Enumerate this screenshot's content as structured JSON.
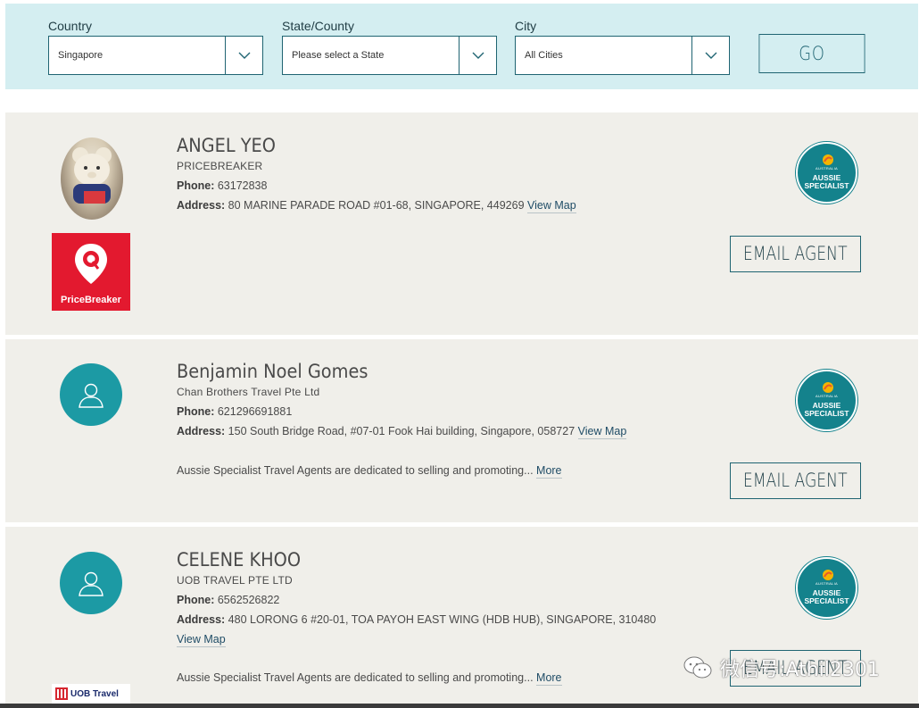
{
  "filters": {
    "country": {
      "label": "Country",
      "value": "Singapore"
    },
    "state": {
      "label": "State/County",
      "value": "Please select a State"
    },
    "city": {
      "label": "City",
      "value": "All Cities"
    },
    "go_label": "GO"
  },
  "agents": [
    {
      "name": "ANGEL YEO",
      "company": "PRICEBREAKER",
      "phone_label": "Phone:",
      "phone": "63172838",
      "address_label": "Address:",
      "address": "80 MARINE PARADE ROAD #01-68, SINGAPORE, 449269",
      "view_map": "View Map",
      "email_label": "EMAIL AGENT",
      "logo_text": "PriceBreaker"
    },
    {
      "name": "Benjamin Noel Gomes",
      "company": "Chan Brothers Travel Pte Ltd",
      "phone_label": "Phone:",
      "phone": "621296691881",
      "address_label": "Address:",
      "address": "150 South Bridge Road, #07-01 Fook Hai building, Singapore, 058727",
      "view_map": "View Map",
      "description": "Aussie Specialist Travel Agents are dedicated to selling and promoting...",
      "more": "More",
      "email_label": "EMAIL AGENT"
    },
    {
      "name": "CELENE KHOO",
      "company": "UOB TRAVEL PTE LTD",
      "phone_label": "Phone:",
      "phone": "6562526822",
      "address_label": "Address:",
      "address": "480 LORONG 6 #20-01, TOA PAYOH EAST WING (HDB HUB), SINGAPORE, 310480",
      "view_map": "View Map",
      "description": "Aussie Specialist Travel Agents are dedicated to selling and promoting...",
      "more": "More",
      "email_label": "EMAIL AGENT",
      "logo_text": "UOB Travel"
    }
  ],
  "badge": {
    "top": "AUSTRALIA",
    "line1": "AUSSIE",
    "line2": "SPECIALIST"
  },
  "watermark": "微信号:Athil2301",
  "colors": {
    "teal": "#1c9aa4",
    "filter_bg": "#d4eef1",
    "card_bg": "#f0efea",
    "pricebreaker_red": "#e3192f"
  },
  "icons": [
    "chevron-down-icon",
    "user-icon",
    "location-pin-icon",
    "kangaroo-icon",
    "wechat-icon"
  ]
}
